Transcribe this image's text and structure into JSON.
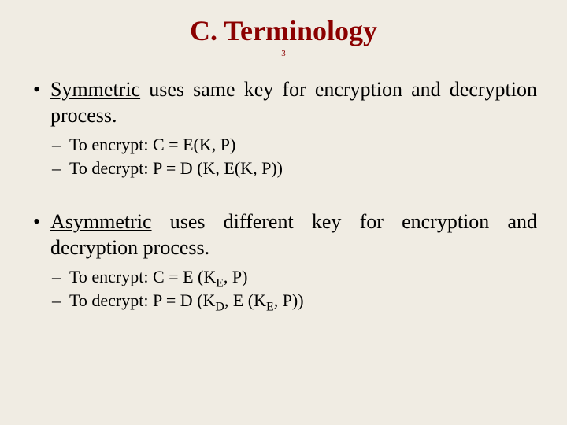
{
  "title": "C. Terminology",
  "pageNumber": "3",
  "bullets": {
    "sym": {
      "term": "Symmetric",
      "rest": " uses same key for encryption and decryption process.",
      "sub": {
        "encrypt": "To encrypt: C = E(K, P)",
        "decrypt": "To decrypt: P = D (K, E(K, P))"
      }
    },
    "asym": {
      "term": "Asymmetric",
      "rest": " uses different key for encryption and decryption process.",
      "sub": {
        "encrypt_pre": "To encrypt: C = E (K",
        "encrypt_sub1": "E",
        "encrypt_mid": ", P)",
        "decrypt_pre": "To decrypt: P = D (K",
        "decrypt_sub1": "D",
        "decrypt_mid": ", E (K",
        "decrypt_sub2": "E",
        "decrypt_end": ", P))"
      }
    }
  }
}
